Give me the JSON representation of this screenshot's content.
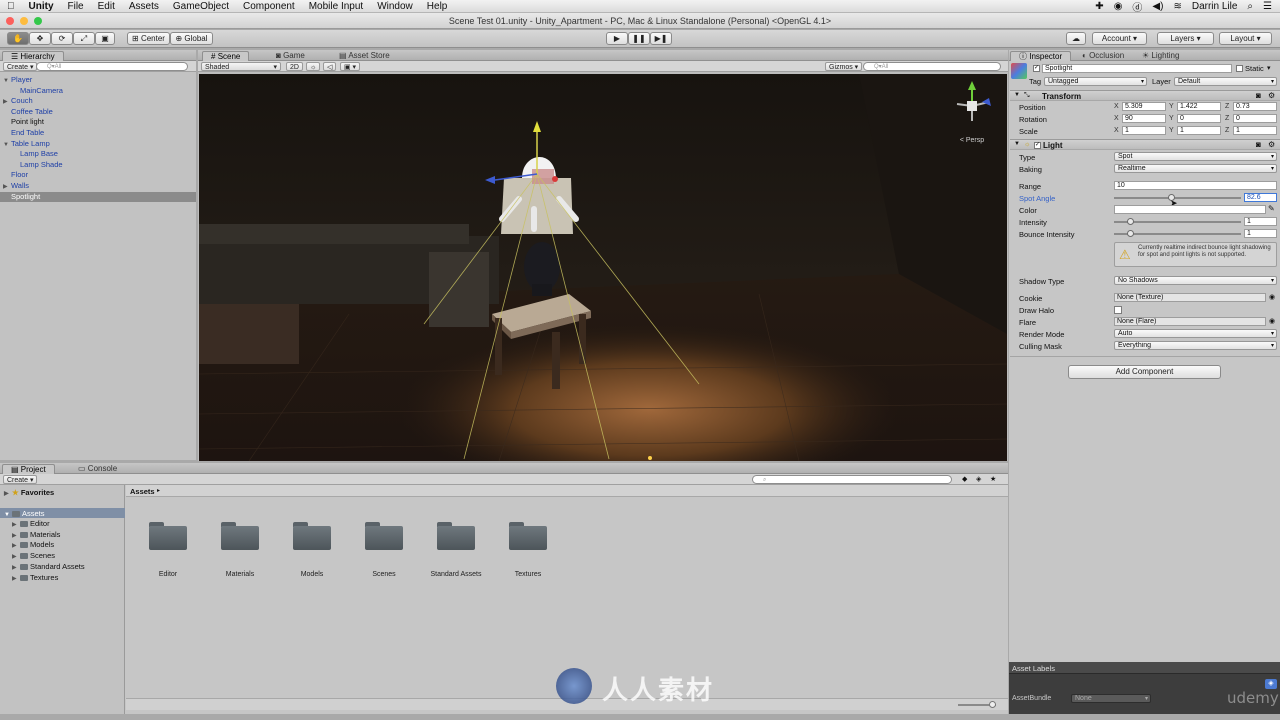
{
  "menubar": {
    "app": "Unity",
    "items": [
      "File",
      "Edit",
      "Assets",
      "GameObject",
      "Component",
      "Mobile Input",
      "Window",
      "Help"
    ],
    "user": "Darrin Lile"
  },
  "window_title": "Scene Test 01.unity - Unity_Apartment - PC, Mac & Linux Standalone (Personal) <OpenGL 4.1>",
  "toolbar": {
    "pivot": "Center",
    "space": "Global",
    "account": "Account",
    "layers": "Layers",
    "layout": "Layout"
  },
  "hierarchy": {
    "tab": "Hierarchy",
    "create": "Create",
    "search": "Q▾All",
    "items": [
      {
        "label": "Player",
        "indent": 0,
        "arrow": "▼",
        "style": "blue"
      },
      {
        "label": "MainCamera",
        "indent": 1,
        "arrow": "",
        "style": "blue"
      },
      {
        "label": "Couch",
        "indent": 0,
        "arrow": "▶",
        "style": "blue"
      },
      {
        "label": "Coffee Table",
        "indent": 0,
        "arrow": "",
        "style": "blue"
      },
      {
        "label": "Point light",
        "indent": 0,
        "arrow": "",
        "style": "black"
      },
      {
        "label": "End Table",
        "indent": 0,
        "arrow": "",
        "style": "blue"
      },
      {
        "label": "Table Lamp",
        "indent": 0,
        "arrow": "▼",
        "style": "blue"
      },
      {
        "label": "Lamp Base",
        "indent": 1,
        "arrow": "",
        "style": "blue"
      },
      {
        "label": "Lamp Shade",
        "indent": 1,
        "arrow": "",
        "style": "blue"
      },
      {
        "label": "Floor",
        "indent": 0,
        "arrow": "",
        "style": "blue"
      },
      {
        "label": "Walls",
        "indent": 0,
        "arrow": "▶",
        "style": "blue"
      },
      {
        "label": "Spotlight",
        "indent": 0,
        "arrow": "",
        "style": "sel"
      }
    ]
  },
  "scene": {
    "tabs": [
      "Scene",
      "Game",
      "Asset Store"
    ],
    "shading": "Shaded",
    "mode_2d": "2D",
    "gizmos": "Gizmos",
    "search": "Q▾All",
    "persp": "< Persp"
  },
  "inspector": {
    "tabs": [
      "Inspector",
      "Occlusion",
      "Lighting"
    ],
    "object_name": "Spotlight",
    "static_label": "Static",
    "tag_label": "Tag",
    "tag_value": "Untagged",
    "layer_label": "Layer",
    "layer_value": "Default",
    "transform": {
      "title": "Transform",
      "rows": [
        {
          "label": "Position",
          "x": "5.309",
          "y": "1.422",
          "z": "0.73"
        },
        {
          "label": "Rotation",
          "x": "90",
          "y": "0",
          "z": "0"
        },
        {
          "label": "Scale",
          "x": "1",
          "y": "1",
          "z": "1"
        }
      ]
    },
    "light": {
      "title": "Light",
      "type_label": "Type",
      "type_value": "Spot",
      "baking_label": "Baking",
      "baking_value": "Realtime",
      "range_label": "Range",
      "range_value": "10",
      "spot_label": "Spot Angle",
      "spot_value": "82.6",
      "spot_fraction": 0.46,
      "color_label": "Color",
      "intensity_label": "Intensity",
      "intensity_value": "1",
      "intensity_fraction": 0.13,
      "bounce_label": "Bounce Intensity",
      "bounce_value": "1",
      "bounce_fraction": 0.13,
      "warning": "Currently realtime indirect bounce light shadowing for spot and point lights is not supported.",
      "shadow_label": "Shadow Type",
      "shadow_value": "No Shadows",
      "cookie_label": "Cookie",
      "cookie_value": "None (Texture)",
      "halo_label": "Draw Halo",
      "flare_label": "Flare",
      "flare_value": "None (Flare)",
      "render_label": "Render Mode",
      "render_value": "Auto",
      "culling_label": "Culling Mask",
      "culling_value": "Everything"
    },
    "add_component": "Add Component",
    "asset_labels": "Asset Labels",
    "asset_bundle_label": "AssetBundle",
    "asset_bundle_value": "None"
  },
  "project": {
    "tabs": [
      "Project",
      "Console"
    ],
    "create": "Create",
    "favorites": "Favorites",
    "root": "Assets",
    "tree": [
      "Editor",
      "Materials",
      "Models",
      "Scenes",
      "Standard Assets",
      "Textures"
    ],
    "breadcrumb": "Assets",
    "folders": [
      "Editor",
      "Materials",
      "Models",
      "Scenes",
      "Standard Assets",
      "Textures"
    ]
  },
  "watermark": "人人素材",
  "brand": "udemy"
}
